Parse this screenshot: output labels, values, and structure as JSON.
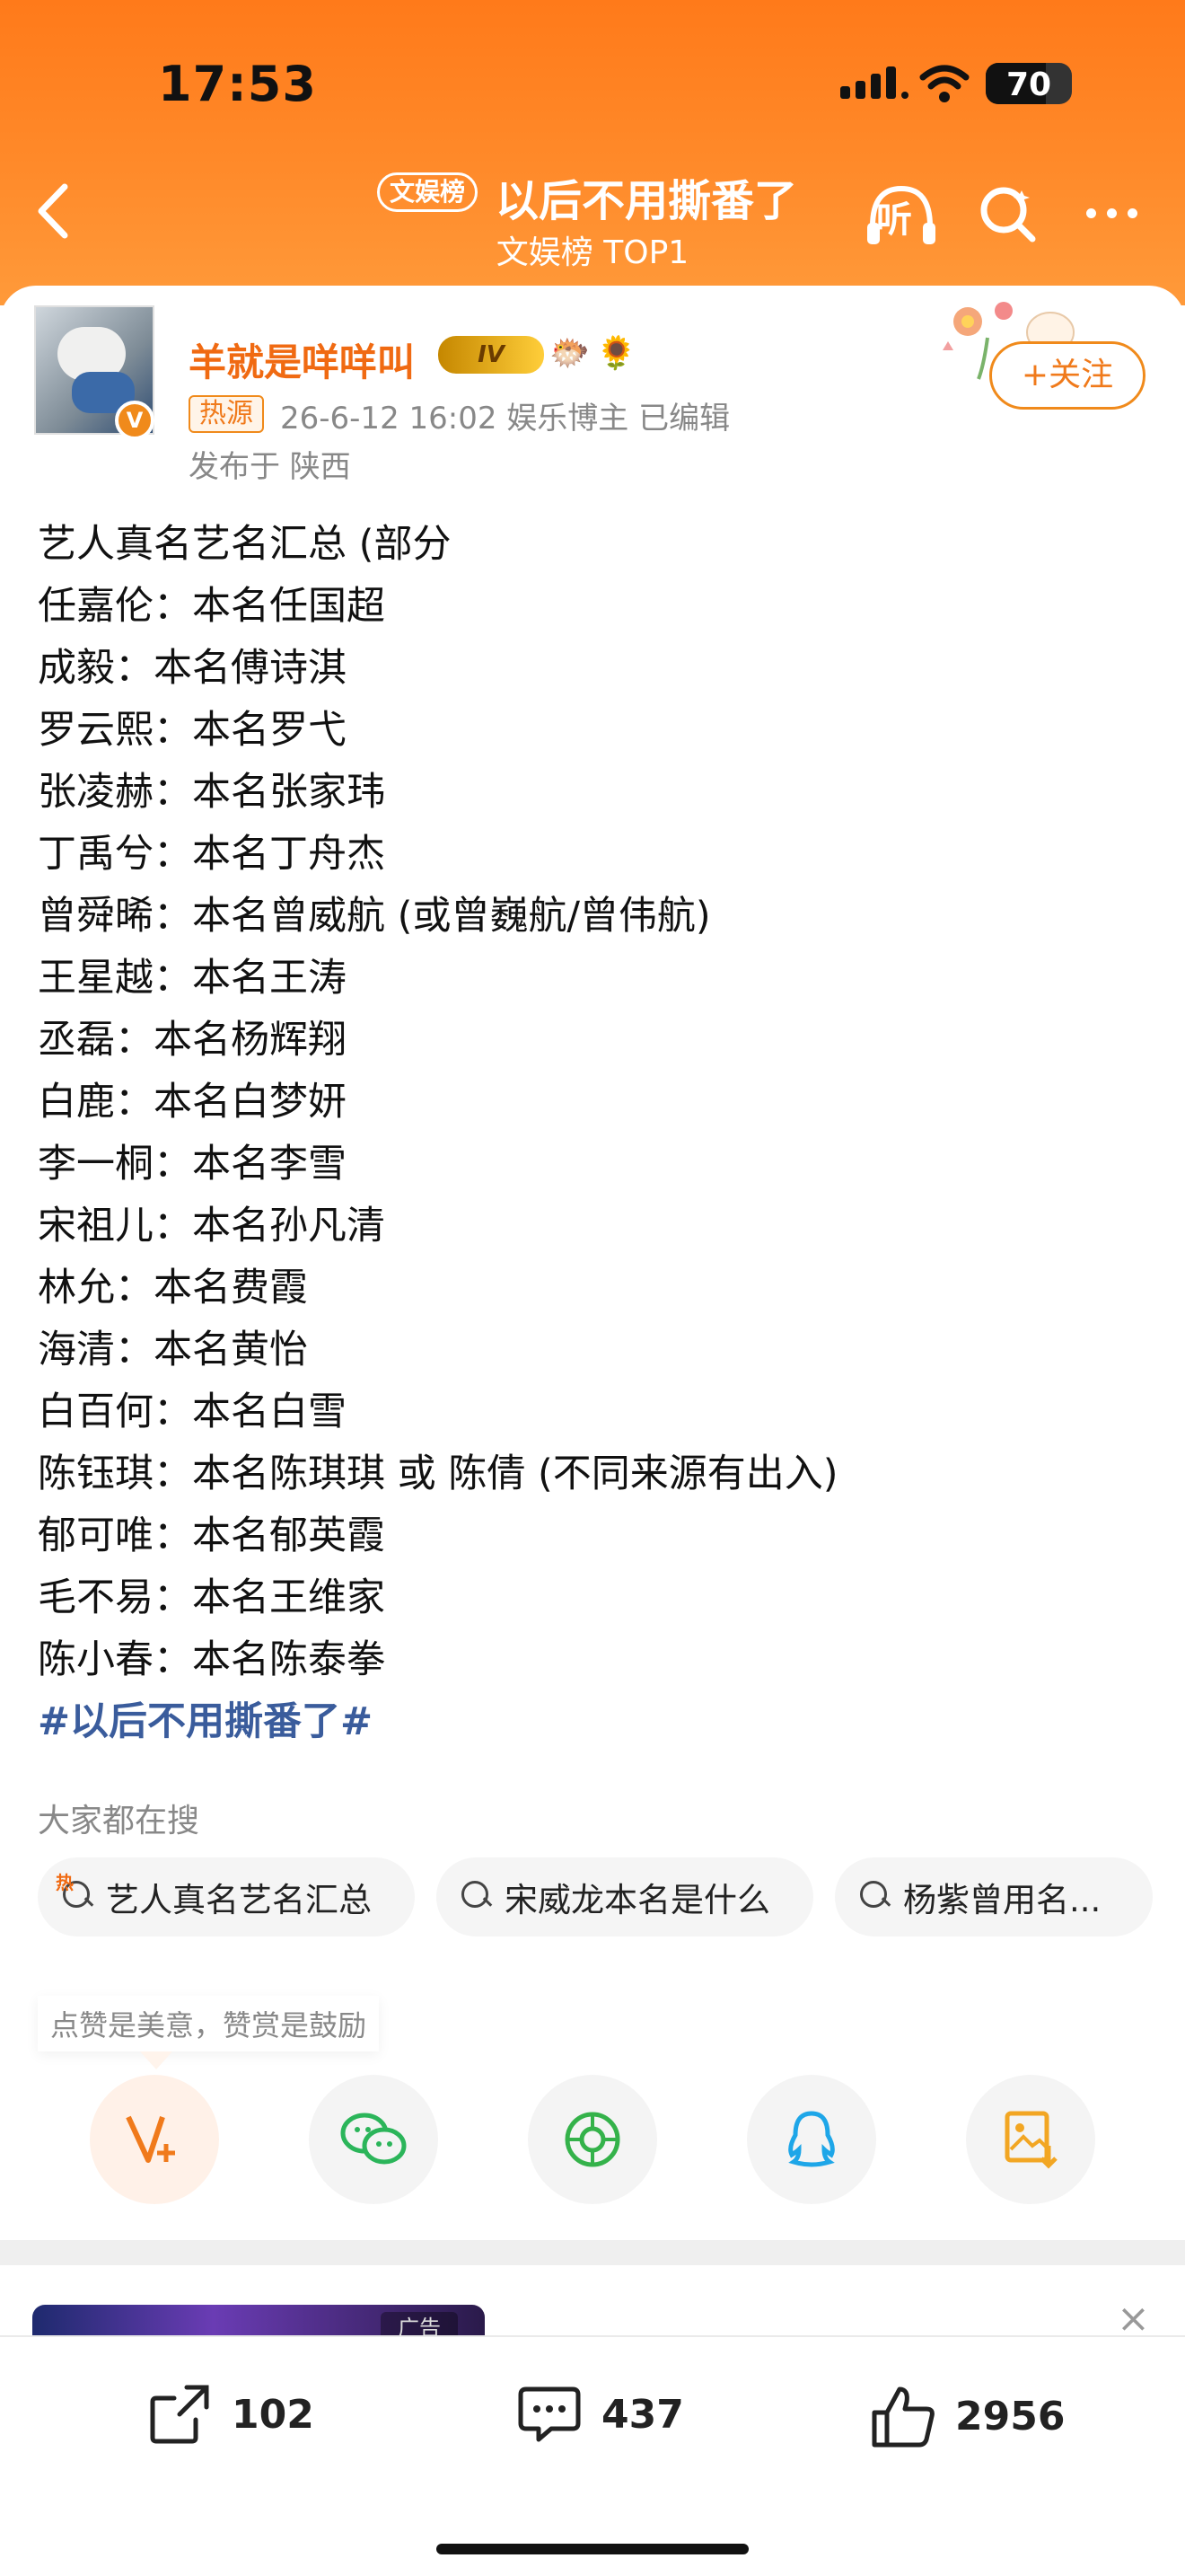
{
  "status_bar": {
    "time": "17:53",
    "battery": "70",
    "battery_level": 0.7
  },
  "nav": {
    "badge": "文娱榜",
    "title": "以后不用撕番了",
    "subtitle": "文娱榜 TOP1",
    "listen_label": "听"
  },
  "post": {
    "author": "羊就是咩咩叫",
    "level": "IV",
    "avatar_badge": "V",
    "source_tag": "热源",
    "meta": "26-6-12 16:02  娱乐博主  已编辑",
    "location": "发布于 陕西",
    "follow_label": "+关注",
    "lines": [
      "艺人真名艺名汇总 (部分",
      "任嘉伦：本名任国超",
      "成毅：本名傅诗淇",
      "罗云熙：本名罗弋",
      "张凌赫：本名张家玮",
      "丁禹兮：本名丁舟杰",
      "曾舜晞：本名曾威航 (或曾巍航/曾伟航)",
      "王星越：本名王涛",
      "丞磊：本名杨辉翔",
      "白鹿：本名白梦妍",
      "李一桐：本名李雪",
      "宋祖儿：本名孙凡清",
      "林允：本名费霞",
      "海清：本名黄怡",
      "白百何：本名白雪",
      "陈钰琪：本名陈琪琪 或 陈倩 (不同来源有出入)",
      "郁可唯：本名郁英霞",
      "毛不易：本名王维家",
      "陈小春：本名陈泰拳"
    ],
    "hashtag": "#以后不用撕番了#"
  },
  "search": {
    "heading": "大家都在搜",
    "hot_mark": "热",
    "items": [
      "艺人真名艺名汇总",
      "宋威龙本名是什么",
      "杨紫曾用名..."
    ]
  },
  "reward": {
    "tip": "点赞是美意，赞赏是鼓励"
  },
  "share_icons": [
    "reward-v-icon",
    "wechat-icon",
    "moments-icon",
    "qq-icon",
    "save-image-icon"
  ],
  "ad": {
    "label": "广告"
  },
  "actions": {
    "share_count": "102",
    "comment_count": "437",
    "like_count": "2956"
  },
  "colors": {
    "brand_orange": "#ff7a1a",
    "name_orange": "#f06a12",
    "hashtag_blue": "#3a5c9c"
  }
}
